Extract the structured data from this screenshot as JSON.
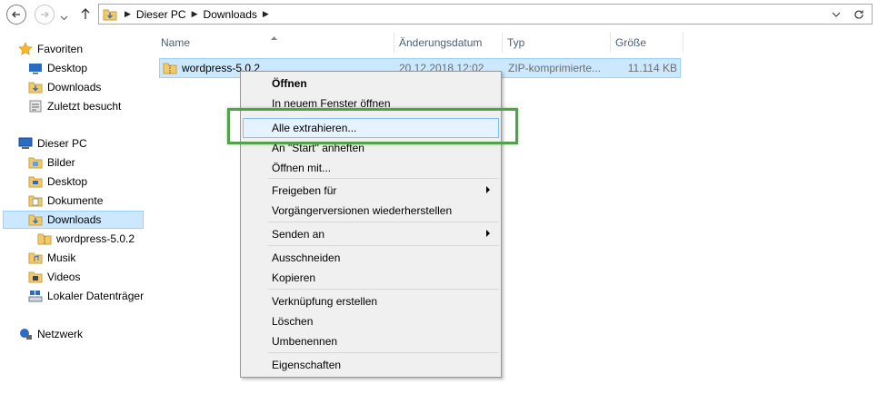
{
  "address": {
    "crumbs": [
      "Dieser PC",
      "Downloads"
    ],
    "dropdown_icon": "chevron-down-icon",
    "refresh_icon": "refresh-icon"
  },
  "sidebar": {
    "favorites_label": "Favoriten",
    "favorites": [
      "Desktop",
      "Downloads",
      "Zuletzt besucht"
    ],
    "this_pc_label": "Dieser PC",
    "this_pc": [
      "Bilder",
      "Desktop",
      "Dokumente",
      "Downloads",
      "wordpress-5.0.2",
      "Musik",
      "Videos",
      "Lokaler Datenträger"
    ],
    "network_label": "Netzwerk"
  },
  "columns": [
    "Name",
    "Änderungsdatum",
    "Typ",
    "Größe"
  ],
  "file": {
    "name": "wordpress-5.0.2",
    "date": "20.12.2018 12:02",
    "type": "ZIP-komprimierte...",
    "size": "11.114 KB"
  },
  "menu": {
    "open": "Öffnen",
    "open_new_window": "In neuem Fenster öffnen",
    "extract_all": "Alle extrahieren...",
    "pin_start": "An \"Start\" anheften",
    "open_with": "Öffnen mit...",
    "share": "Freigeben für",
    "restore": "Vorgängerversionen wiederherstellen",
    "send_to": "Senden an",
    "cut": "Ausschneiden",
    "copy": "Kopieren",
    "create_shortcut": "Verknüpfung erstellen",
    "delete": "Löschen",
    "rename": "Umbenennen",
    "properties": "Eigenschaften"
  },
  "colors": {
    "selection": "#cce8ff",
    "highlight_box": "#54a14c",
    "menu_bg": "#f0f0f0"
  }
}
